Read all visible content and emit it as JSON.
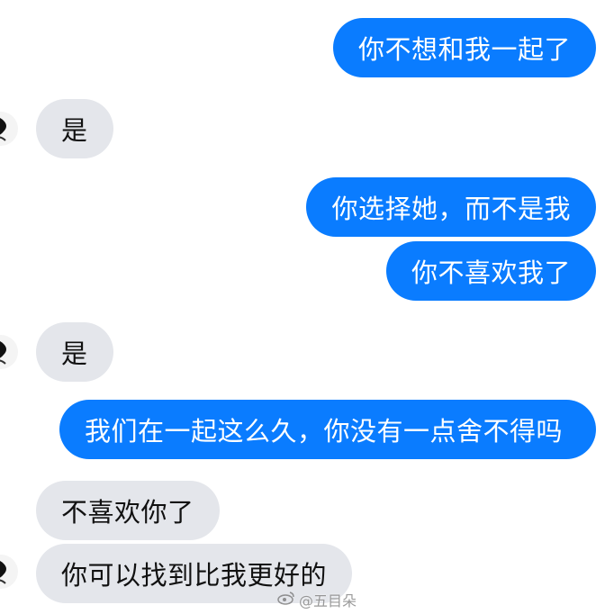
{
  "messages": [
    {
      "from": "me",
      "text": "你不想和我一起了"
    },
    {
      "from": "them",
      "text": "是"
    },
    {
      "from": "me",
      "text": "你选择她，而不是我"
    },
    {
      "from": "me",
      "text": "你不喜欢我了"
    },
    {
      "from": "them",
      "text": "是"
    },
    {
      "from": "me",
      "text": "我们在一起这么久，你没有一点舍不得吗"
    },
    {
      "from": "them",
      "text": "不喜欢你了"
    },
    {
      "from": "them",
      "text": "你可以找到比我更好的"
    }
  ],
  "watermark": {
    "text": "@五目朵"
  },
  "colors": {
    "outgoing": "#0a7cff",
    "incoming": "#e4e6eb"
  },
  "icons": {
    "avatar": "contact-avatar",
    "watermark": "weibo-logo"
  }
}
